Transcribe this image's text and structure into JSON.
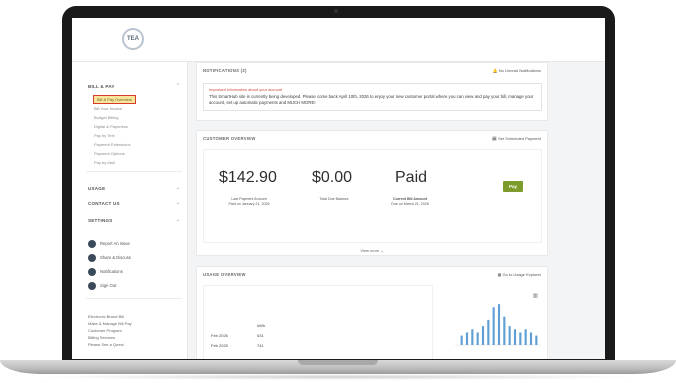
{
  "header": {
    "logo": "TEA"
  },
  "sidebar": {
    "bill_pay": "BILL & PAY",
    "bill_pay_items": [
      "Bill & Pay Overview",
      "Bill Your Invoice",
      "Budget Billing",
      "Digital & Paperless",
      "Pay by Text",
      "Payment Extensions",
      "Payment Options",
      "Pay by Mail"
    ],
    "usage": "USAGE",
    "contact_us": "CONTACT US",
    "settings": "SETTINGS",
    "round_items": [
      "Report An Issue",
      "Share & Discuss",
      "Notifications",
      "Sign Out"
    ],
    "links": [
      "Electronic Brand Bill",
      "Make & Manage Bill Pay",
      "Customer Program",
      "Billing Services",
      "Please See a Quest"
    ]
  },
  "notifications": {
    "title": "NOTIFICATIONS (2)",
    "action": "No Unread Notifications",
    "headline": "Important Information about your account",
    "message": "This SmartHub site is currently being developed. Please come back April 10th, 2026 to enjoy your new customer portal where you can view and pay your bill, manage your account, set up automatic payments and MUCH MORE!"
  },
  "overview": {
    "title": "CUSTOMER OVERVIEW",
    "action": "Set Scheduled Payment",
    "last_payment": "$142.90",
    "last_payment_label": "Last Payment Amount",
    "last_payment_date": "Paid on January 21, 2026",
    "total_due": "$0.00",
    "total_due_label": "Total Due Balance",
    "status": "Paid",
    "status_label": "Current Bill Amount",
    "status_date": "Due on March 21, 2026",
    "pay_button": "Pay",
    "view_more": "View more"
  },
  "usage": {
    "title": "USAGE OVERVIEW",
    "action": "Go to Usage Explorer",
    "table_header": "kWh",
    "rows": [
      {
        "month": "Feb 2026",
        "value": "631"
      },
      {
        "month": "Feb 2025",
        "value": "741"
      }
    ]
  },
  "chart_data": {
    "type": "bar",
    "values": [
      3,
      4,
      5,
      4,
      6,
      8,
      12,
      13,
      9,
      6,
      5,
      4,
      5,
      4,
      3
    ],
    "title": "",
    "xlabel": "",
    "ylabel": "",
    "ylim": [
      0,
      14
    ]
  },
  "colors": {
    "pay": "#7d9c2c",
    "highlight": "#d93a2b"
  }
}
